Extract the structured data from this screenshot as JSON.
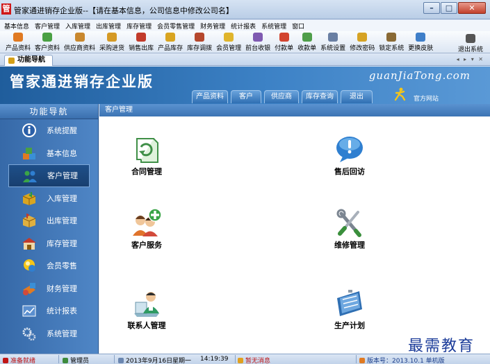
{
  "window": {
    "logo_char": "管",
    "title": "管家通进销存企业版--【请在基本信息，公司信息中修改公司名】"
  },
  "menu": [
    "基本信息",
    "客户管理",
    "入库管理",
    "出库管理",
    "库存管理",
    "会员零售管理",
    "财务管理",
    "统计报表",
    "系统管理",
    "窗口"
  ],
  "toolbar": {
    "items": [
      {
        "label": "产品资料",
        "icon": "product-icon",
        "color": "#e07a22"
      },
      {
        "label": "客户资料",
        "icon": "customer-icon",
        "color": "#4aa043"
      },
      {
        "label": "供应商资料",
        "icon": "supplier-icon",
        "color": "#c9882e"
      },
      {
        "label": "采购进货",
        "icon": "purchase-icon",
        "color": "#d59a25"
      },
      {
        "label": "销售出库",
        "icon": "sales-icon",
        "color": "#c23b2b"
      },
      {
        "label": "产品库存",
        "icon": "stock-icon",
        "color": "#d9a521"
      },
      {
        "label": "库存调拨",
        "icon": "transfer-icon",
        "color": "#b5482d"
      },
      {
        "label": "会员管理",
        "icon": "member-icon",
        "color": "#e0b52c"
      },
      {
        "label": "前台收银",
        "icon": "cashier-icon",
        "color": "#7f5ab1"
      },
      {
        "label": "付款单",
        "icon": "payment-icon",
        "color": "#d2442f"
      },
      {
        "label": "收款单",
        "icon": "receipt-icon",
        "color": "#4f9e49"
      },
      {
        "label": "系统设置",
        "icon": "settings-icon",
        "color": "#6a7fa3"
      },
      {
        "label": "修改密码",
        "icon": "password-icon",
        "color": "#d6a324"
      },
      {
        "label": "锁定系统",
        "icon": "lock-icon",
        "color": "#8a6a35"
      },
      {
        "label": "更换皮肤",
        "icon": "skin-icon",
        "color": "#3f7fc9"
      }
    ],
    "exit": {
      "label": "退出系统",
      "icon": "exit-icon",
      "color": "#555555"
    }
  },
  "tab": {
    "label": "功能导航",
    "nav": "◂ ▸ ▾ ✕"
  },
  "banner": {
    "title": "管家通进销存企业版",
    "site": "guanJiaTong.com",
    "quick_tabs": [
      {
        "label": "产品资料",
        "w": 52
      },
      {
        "label": "客户",
        "w": 44
      },
      {
        "label": "供应商",
        "w": 50
      },
      {
        "label": "库存查询",
        "w": 52
      },
      {
        "label": "退出",
        "w": 46
      }
    ],
    "official": "官方网站"
  },
  "sidebar": {
    "title": "功能导航",
    "items": [
      {
        "label": "系统提醒",
        "name": "sidebar-item-system-reminder",
        "icon": "info-icon"
      },
      {
        "label": "基本信息",
        "name": "sidebar-item-basic-info",
        "icon": "cubes-icon"
      },
      {
        "label": "客户管理",
        "name": "sidebar-item-customer-management",
        "icon": "customers-icon",
        "active": true
      },
      {
        "label": "入库管理",
        "name": "sidebar-item-inbound",
        "icon": "inbound-box-icon"
      },
      {
        "label": "出库管理",
        "name": "sidebar-item-outbound",
        "icon": "outbound-box-icon"
      },
      {
        "label": "库存管理",
        "name": "sidebar-item-inventory",
        "icon": "warehouse-icon"
      },
      {
        "label": "会员零售",
        "name": "sidebar-item-member-retail",
        "icon": "member-icon"
      },
      {
        "label": "财务管理",
        "name": "sidebar-item-finance",
        "icon": "finance-icon"
      },
      {
        "label": "统计报表",
        "name": "sidebar-item-reports",
        "icon": "report-icon"
      },
      {
        "label": "系统管理",
        "name": "sidebar-item-system",
        "icon": "gears-icon"
      }
    ]
  },
  "content": {
    "breadcrumb": "客户管理",
    "functions": [
      {
        "label": "合同管理",
        "icon": "contract-icon"
      },
      {
        "label": "售后回访",
        "icon": "after-sales-icon"
      },
      {
        "label": "客户服务",
        "icon": "customer-service-icon"
      },
      {
        "label": "维修管理",
        "icon": "repair-icon"
      },
      {
        "label": "联系人管理",
        "icon": "contacts-icon"
      },
      {
        "label": "生产计划",
        "icon": "production-plan-icon"
      }
    ]
  },
  "watermark": "最需教育",
  "status": {
    "ready": "准备就绪",
    "user": "管理员",
    "date": "2013年9月16日",
    "weekday": "星期一",
    "time": "14:19:39",
    "message": "暂无消息",
    "version": "版本号：2013.10.1 单机版"
  }
}
